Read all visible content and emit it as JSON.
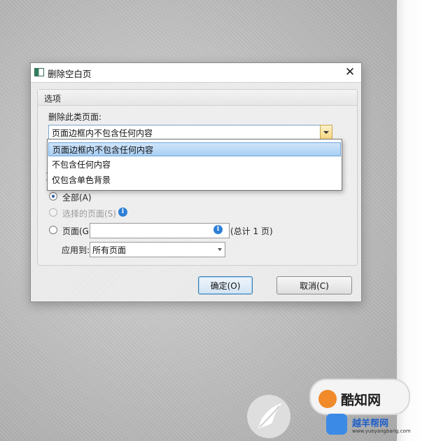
{
  "dialog": {
    "title": "删除空白页",
    "close_label": "✕",
    "group_title": "选项",
    "delete_label": "删除此类页面:",
    "combo_value": "页面边框内不包含任何内容",
    "dropdown_options": [
      "页面边框内不包含任何内容",
      "不包含任何内容",
      "仅包含单色背景"
    ],
    "range_label_partial": "页",
    "radio_all": "全部(A)",
    "radio_selected": "选择的页面(S)",
    "radio_pages": "页面(G)",
    "pages_value": "",
    "total_text": "(总计 1 页)",
    "apply_to_label": "应用到:",
    "apply_to_value": "所有页面",
    "ok_label": "确定(O)",
    "cancel_label": "取消(C)"
  },
  "watermark": {
    "brand": "酷知网",
    "site_name": "越羊帮网",
    "site_url": "www.yueyangbang.com"
  },
  "colors": {
    "selection": "#a9cff3",
    "info_icon": "#2d7fd6",
    "radio_dot": "#2a5aa4",
    "brand_orange": "#f08a2a",
    "site_blue": "#3b8be6"
  }
}
